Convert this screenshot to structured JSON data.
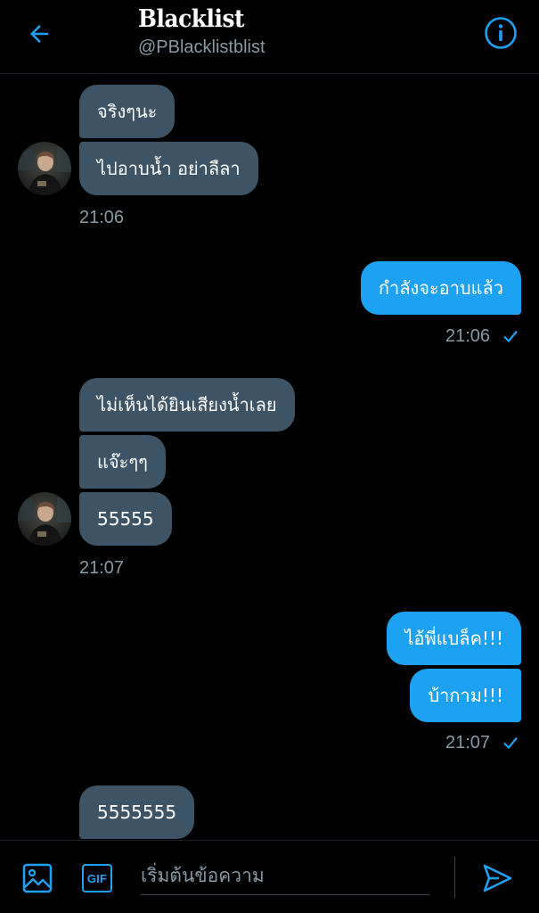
{
  "header": {
    "title": "Blacklist",
    "handle": "@PBlacklistblist",
    "back_icon": "arrow-left-icon",
    "info_icon": "info-circle-icon"
  },
  "colors": {
    "accent": "#1da1f2",
    "incoming_bubble": "#3d5466",
    "background": "#000000",
    "secondary_text": "#8899a6"
  },
  "messages": {
    "group1": {
      "m1": "จริงๆนะ",
      "m2": "ไปอาบน้ำ อย่าลืลา",
      "time": "21:06"
    },
    "group2": {
      "m1": "กำลังจะอาบแล้ว",
      "time": "21:06"
    },
    "group3": {
      "m1": "ไม่เห็นได้ยินเสียงน้ำเลย",
      "m2": "แจ๊ะๆๆ",
      "m3": "55555",
      "time": "21:07"
    },
    "group4": {
      "m1": "ไอ้พี่แบล็ค!!!",
      "m2": "บ้ากาม!!!",
      "time": "21:07"
    },
    "group5": {
      "m1": "5555555"
    }
  },
  "composer": {
    "placeholder": "เริ่มต้นข้อความ",
    "gif_label": "GIF",
    "image_icon": "image-icon",
    "send_icon": "send-icon"
  }
}
